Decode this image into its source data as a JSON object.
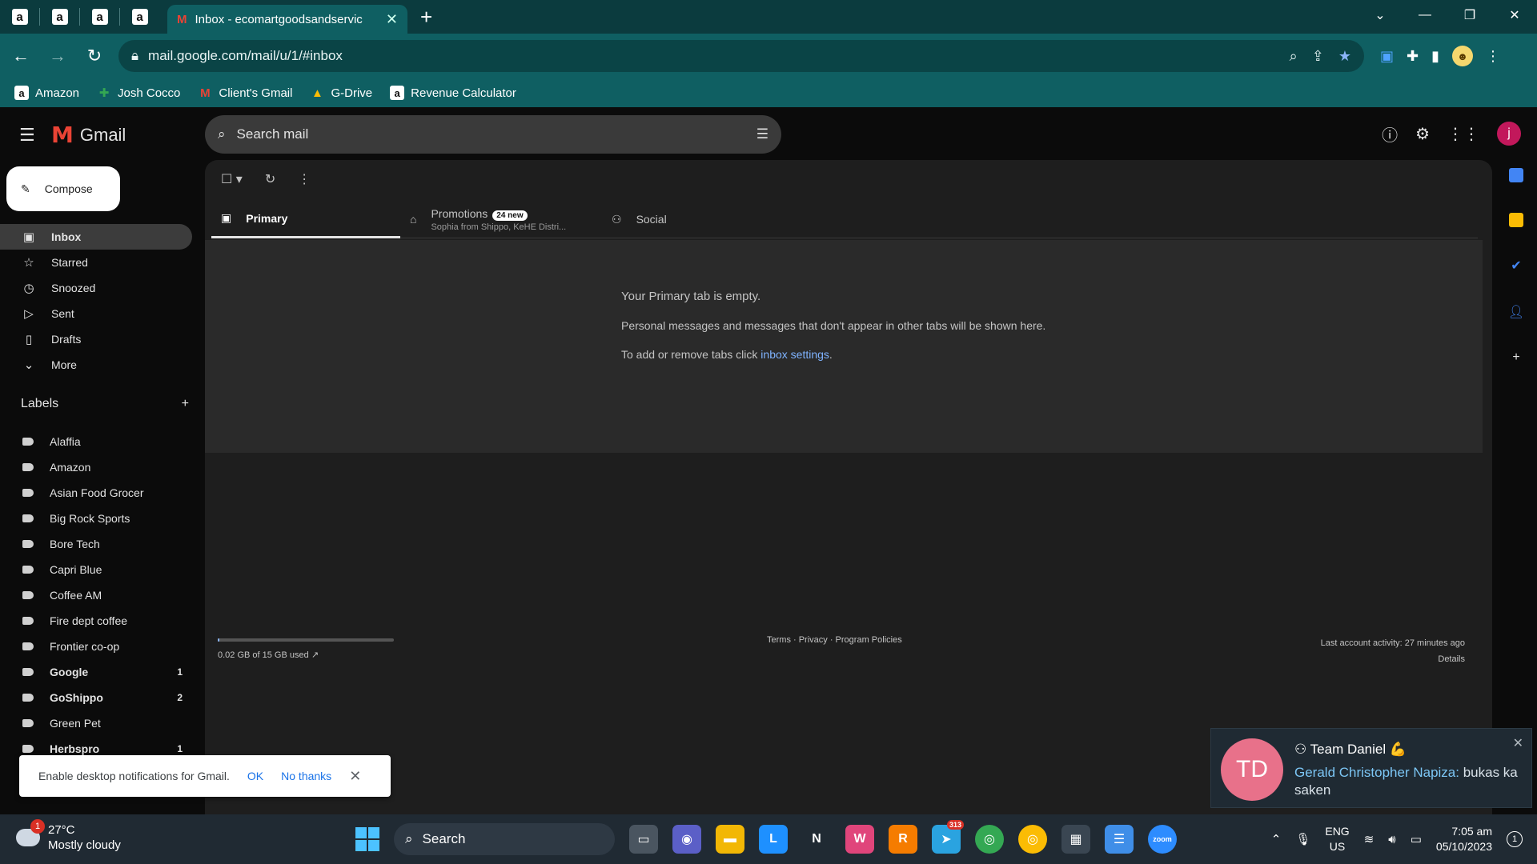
{
  "browser": {
    "pinned_tab_glyph": "a",
    "active_tab_title": "Inbox - ecomartgoodsandservic",
    "newtab_glyph": "+",
    "url": "mail.google.com/mail/u/1/#inbox",
    "bookmarks": [
      {
        "label": "Amazon",
        "icon": "amazon-icon"
      },
      {
        "label": "Josh Cocco",
        "icon": "plus-icon"
      },
      {
        "label": "Client's Gmail",
        "icon": "gmail-icon"
      },
      {
        "label": "G-Drive",
        "icon": "drive-icon"
      },
      {
        "label": "Revenue Calculator",
        "icon": "amazon-icon"
      }
    ]
  },
  "gmail": {
    "product_name": "Gmail",
    "search_placeholder": "Search mail",
    "avatar_letter": "j",
    "compose_label": "Compose",
    "nav": [
      {
        "label": "Inbox",
        "icon": "inbox-icon",
        "active": true
      },
      {
        "label": "Starred",
        "icon": "star-icon"
      },
      {
        "label": "Snoozed",
        "icon": "clock-icon"
      },
      {
        "label": "Sent",
        "icon": "send-icon"
      },
      {
        "label": "Drafts",
        "icon": "draft-icon"
      },
      {
        "label": "More",
        "icon": "chevron-down-icon"
      }
    ],
    "labels_heading": "Labels",
    "labels": [
      {
        "name": "Alaffia",
        "count": ""
      },
      {
        "name": "Amazon",
        "count": ""
      },
      {
        "name": "Asian Food Grocer",
        "count": ""
      },
      {
        "name": "Big Rock Sports",
        "count": ""
      },
      {
        "name": "Bore Tech",
        "count": ""
      },
      {
        "name": "Capri Blue",
        "count": ""
      },
      {
        "name": "Coffee AM",
        "count": ""
      },
      {
        "name": "Fire dept coffee",
        "count": ""
      },
      {
        "name": "Frontier co-op",
        "count": ""
      },
      {
        "name": "Google",
        "count": "1",
        "bold": true
      },
      {
        "name": "GoShippo",
        "count": "2",
        "bold": true
      },
      {
        "name": "Green Pet",
        "count": ""
      },
      {
        "name": "Herbspro",
        "count": "1",
        "bold": true
      }
    ],
    "tabs": {
      "primary": "Primary",
      "promotions": "Promotions",
      "promotions_badge": "24 new",
      "promotions_sub": "Sophia from Shippo, KeHE Distri...",
      "social": "Social"
    },
    "empty": {
      "title": "Your Primary tab is empty.",
      "line1": "Personal messages and messages that don't appear in other tabs will be shown here.",
      "line2_prefix": "To add or remove tabs click ",
      "line2_link": "inbox settings",
      "line2_suffix": "."
    },
    "footer": {
      "storage": "0.02 GB of 15 GB used",
      "storage_fraction": 0.0013,
      "links": "Terms · Privacy · Program Policies",
      "activity": "Last account activity: 27 minutes ago",
      "details": "Details"
    },
    "notification_bar": {
      "text": "Enable desktop notifications for Gmail.",
      "ok": "OK",
      "no_thanks": "No thanks"
    }
  },
  "toast": {
    "avatar": "TD",
    "title": "Team Daniel 💪",
    "sender": "Gerald Christopher Napiza:",
    "message": " bukas ka saken"
  },
  "taskbar": {
    "weather_badge": "1",
    "temperature": "27°C",
    "condition": "Mostly cloudy",
    "search": "Search",
    "telegram_badge": "313",
    "lang_top": "ENG",
    "lang_bottom": "US",
    "time": "7:05 am",
    "date": "05/10/2023",
    "notif_count": "1"
  }
}
